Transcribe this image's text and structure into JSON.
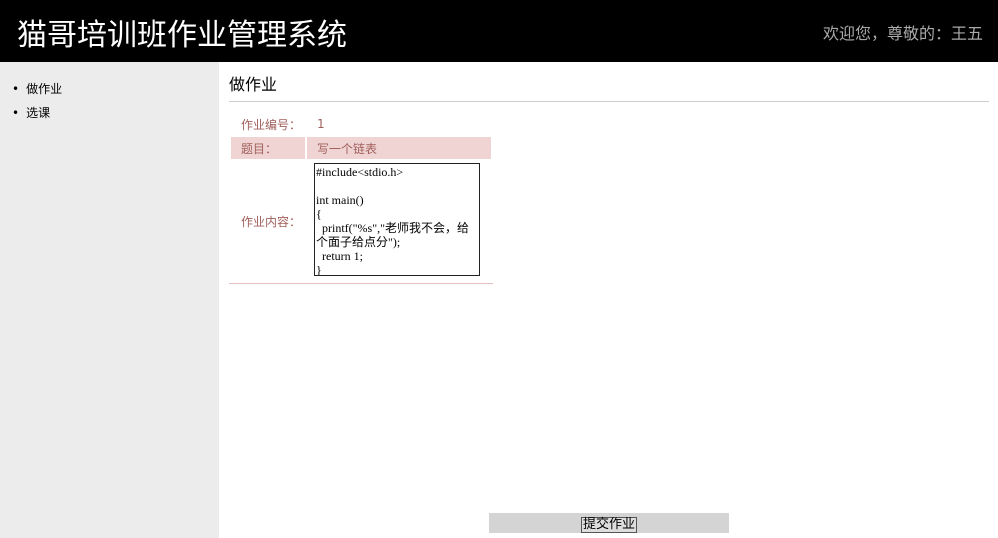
{
  "header": {
    "title": "猫哥培训班作业管理系统",
    "welcome": "欢迎您，尊敬的：王五"
  },
  "sidebar": {
    "items": [
      {
        "label": "做作业"
      },
      {
        "label": "选课"
      }
    ]
  },
  "main": {
    "title": "做作业",
    "form": {
      "id_label": "作业编号：",
      "id_value": "1",
      "topic_label": "题目：",
      "topic_value": "写一个链表",
      "content_label": "作业内容：",
      "content_value": "#include<stdio.h>\n\nint main()\n{\n  printf(\"%s\",\"老师我不会，给个面子给点分\");\n  return 1;\n}"
    },
    "submit_label": "提交作业"
  }
}
